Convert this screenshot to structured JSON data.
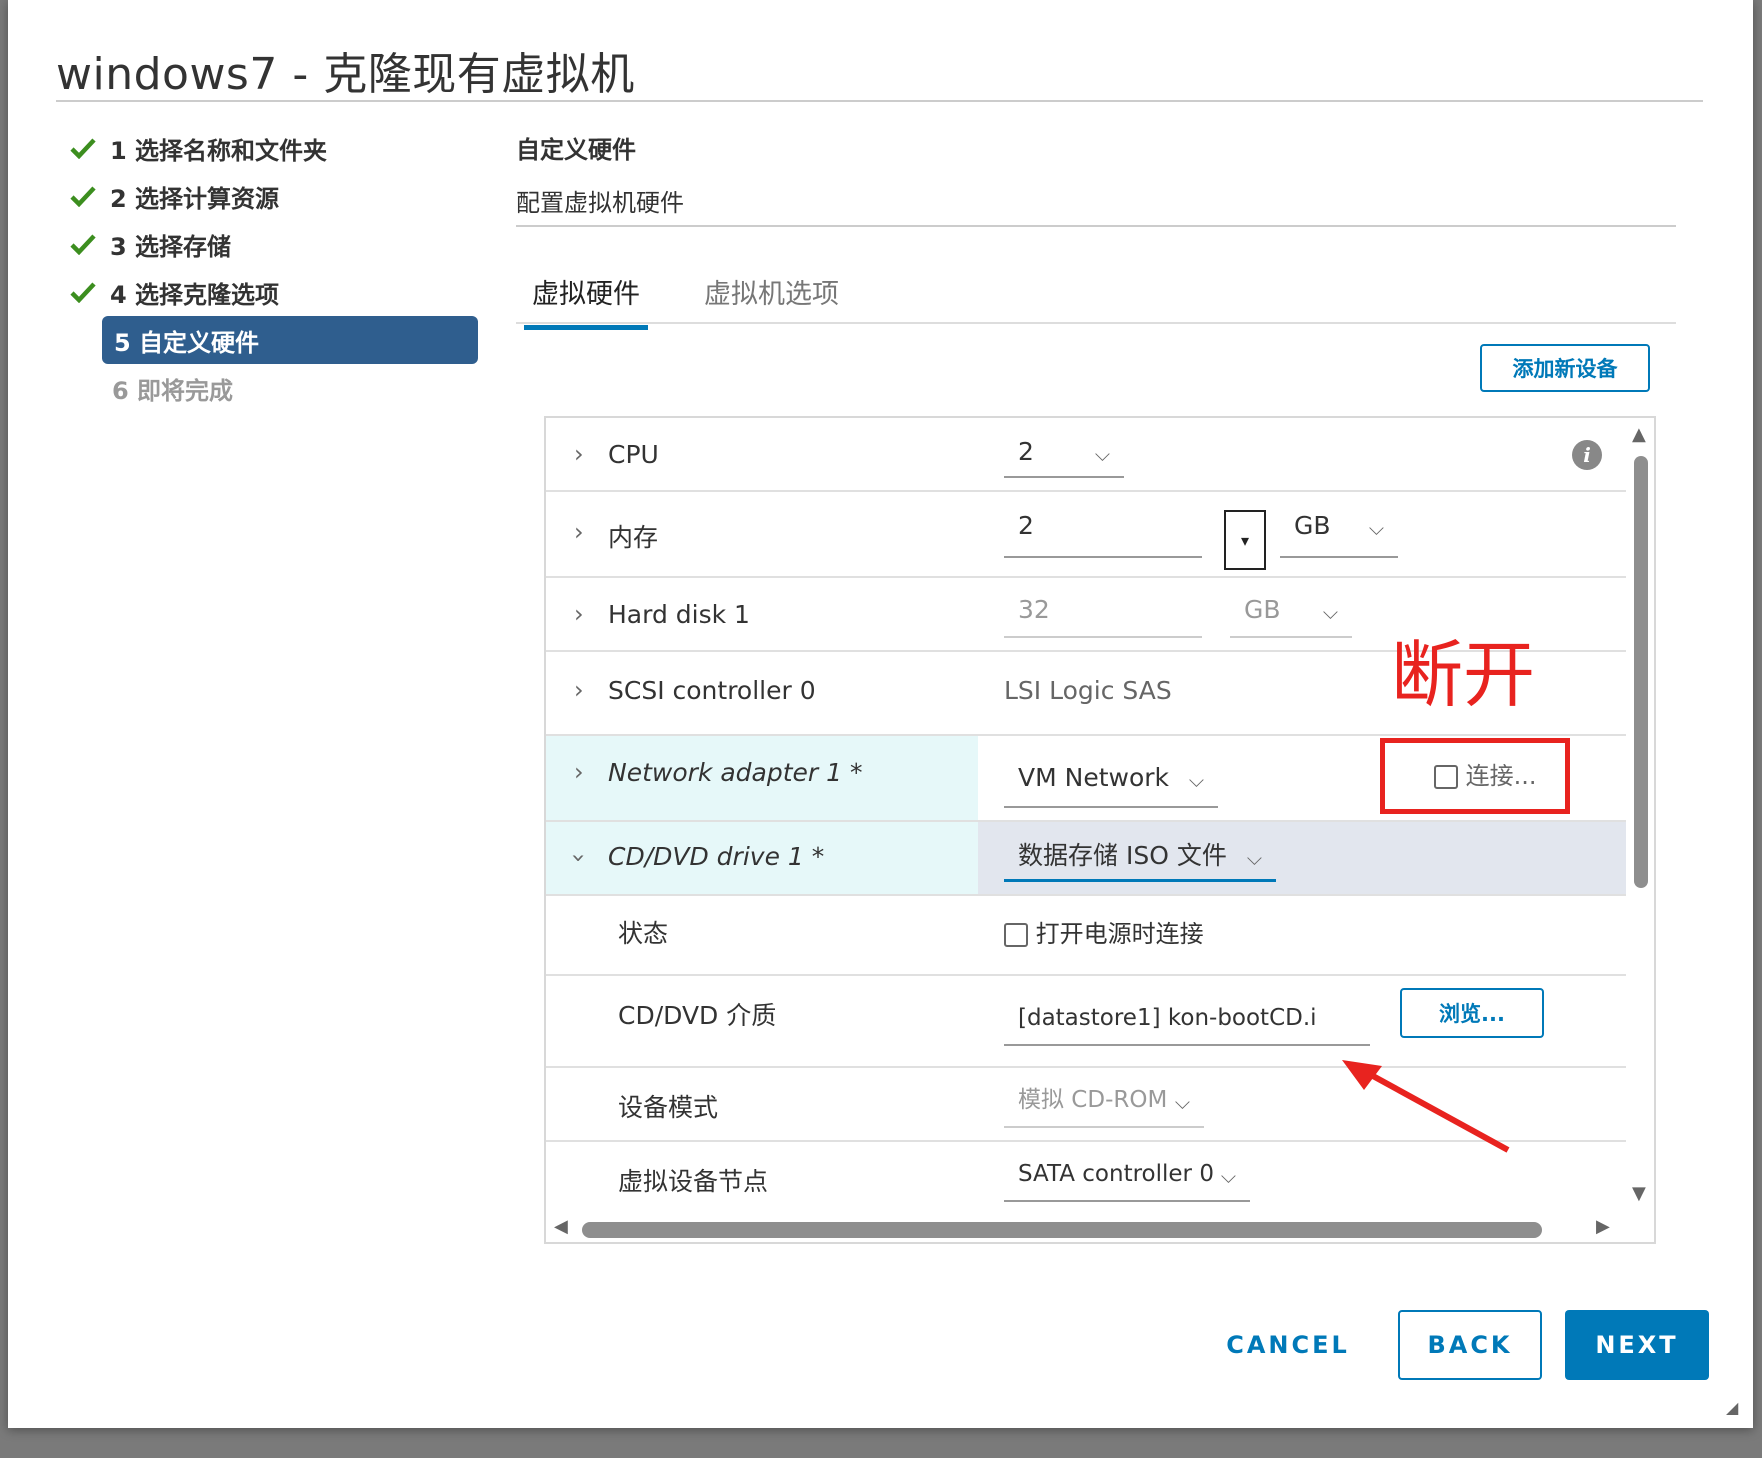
{
  "dialog": {
    "title": "windows7 - 克隆现有虚拟机"
  },
  "steps": [
    {
      "label": "1 选择名称和文件夹",
      "state": "done"
    },
    {
      "label": "2 选择计算资源",
      "state": "done"
    },
    {
      "label": "3 选择存储",
      "state": "done"
    },
    {
      "label": "4 选择克隆选项",
      "state": "done"
    },
    {
      "label": "5 自定义硬件",
      "state": "active"
    },
    {
      "label": "6 即将完成",
      "state": "future"
    }
  ],
  "content": {
    "title": "自定义硬件",
    "subtitle": "配置虚拟机硬件"
  },
  "tabs": [
    {
      "label": "虚拟硬件",
      "selected": true
    },
    {
      "label": "虚拟机选项",
      "selected": false
    }
  ],
  "toolbar": {
    "add_device_label": "添加新设备"
  },
  "hardware": {
    "cpu": {
      "label": "CPU",
      "value": "2"
    },
    "memory": {
      "label": "内存",
      "value": "2",
      "unit": "GB"
    },
    "hard_disk": {
      "label": "Hard disk 1",
      "value": "32",
      "unit": "GB"
    },
    "scsi": {
      "label": "SCSI controller 0",
      "value": "LSI Logic SAS"
    },
    "network": {
      "label": "Network adapter 1 *",
      "value": "VM Network",
      "connect_label": "连接..."
    },
    "cdrom": {
      "label": "CD/DVD drive 1 *",
      "value": "数据存储 ISO 文件",
      "status_label": "状态",
      "status_option": "打开电源时连接",
      "media_label": "CD/DVD 介质",
      "media_value": "[datastore1] kon-bootCD.i",
      "browse_label": "浏览...",
      "mode_label": "设备模式",
      "mode_value": "模拟 CD-ROM",
      "node_label": "虚拟设备节点",
      "node_value": "SATA controller 0"
    }
  },
  "annotation": {
    "text": "断开",
    "color": "#e8231f"
  },
  "footer": {
    "cancel_label": "CANCEL",
    "back_label": "BACK",
    "next_label": "NEXT"
  },
  "colors": {
    "accent": "#0079b8",
    "active_step_bg": "#2f5e8e",
    "check_green": "#3c8e1f",
    "network_row_bg": "#e6f8f9",
    "cdrom_row_bg": "#e2e6ee"
  }
}
